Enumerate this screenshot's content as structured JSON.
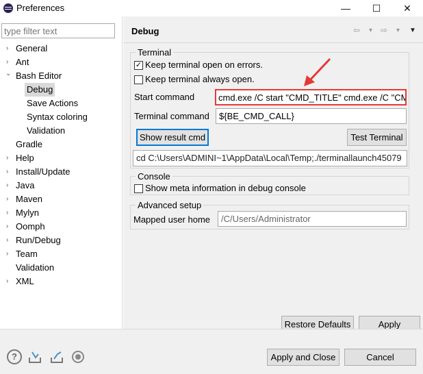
{
  "window": {
    "title": "Preferences",
    "minimize": "—",
    "maximize": "☐",
    "close": "✕"
  },
  "filter": {
    "placeholder": "type filter text"
  },
  "tree": [
    {
      "label": "General",
      "arrow": "›"
    },
    {
      "label": "Ant",
      "arrow": "›"
    },
    {
      "label": "Bash Editor",
      "arrow": "⌄"
    },
    {
      "label": "Debug",
      "arrow": ""
    },
    {
      "label": "Save Actions",
      "arrow": ""
    },
    {
      "label": "Syntax coloring",
      "arrow": ""
    },
    {
      "label": "Validation",
      "arrow": ""
    },
    {
      "label": "Gradle",
      "arrow": ""
    },
    {
      "label": "Help",
      "arrow": "›"
    },
    {
      "label": "Install/Update",
      "arrow": "›"
    },
    {
      "label": "Java",
      "arrow": "›"
    },
    {
      "label": "Maven",
      "arrow": "›"
    },
    {
      "label": "Mylyn",
      "arrow": "›"
    },
    {
      "label": "Oomph",
      "arrow": "›"
    },
    {
      "label": "Run/Debug",
      "arrow": "›"
    },
    {
      "label": "Team",
      "arrow": "›"
    },
    {
      "label": "Validation",
      "arrow": ""
    },
    {
      "label": "XML",
      "arrow": "›"
    }
  ],
  "page": {
    "title": "Debug",
    "nav": {
      "back": "⇦",
      "forward": "⇨",
      "dropdown": "▾",
      "menu": "▼"
    },
    "terminal": {
      "group_label": "Terminal",
      "keep_open_errors": {
        "label": "Keep terminal open on errors.",
        "mark": "✓"
      },
      "keep_open_always": {
        "label": "Keep terminal always open.",
        "mark": ""
      },
      "start_command_label": "Start command",
      "start_command_value": "cmd.exe /C start \"CMD_TITLE\" cmd.exe /C \"CM",
      "terminal_command_label": "Terminal command",
      "terminal_command_value": "${BE_CMD_CALL}",
      "show_result_button": "Show result cmd",
      "test_terminal_button": "Test Terminal",
      "result_value": "cd C:\\Users\\ADMINI~1\\AppData\\Local\\Temp;./terminallaunch45079"
    },
    "console": {
      "group_label": "Console",
      "show_meta": {
        "label": "Show meta information in debug console",
        "mark": ""
      }
    },
    "advanced": {
      "group_label": "Advanced setup",
      "mapped_user_home_label": "Mapped user home",
      "mapped_user_home_value": "/C/Users/Administrator"
    },
    "restore_defaults": "Restore Defaults",
    "apply": "Apply"
  },
  "footer": {
    "apply_and_close": "Apply and Close",
    "cancel": "Cancel"
  },
  "colors": {
    "focus": "#0078d7",
    "annotation_red": "#e53935"
  }
}
